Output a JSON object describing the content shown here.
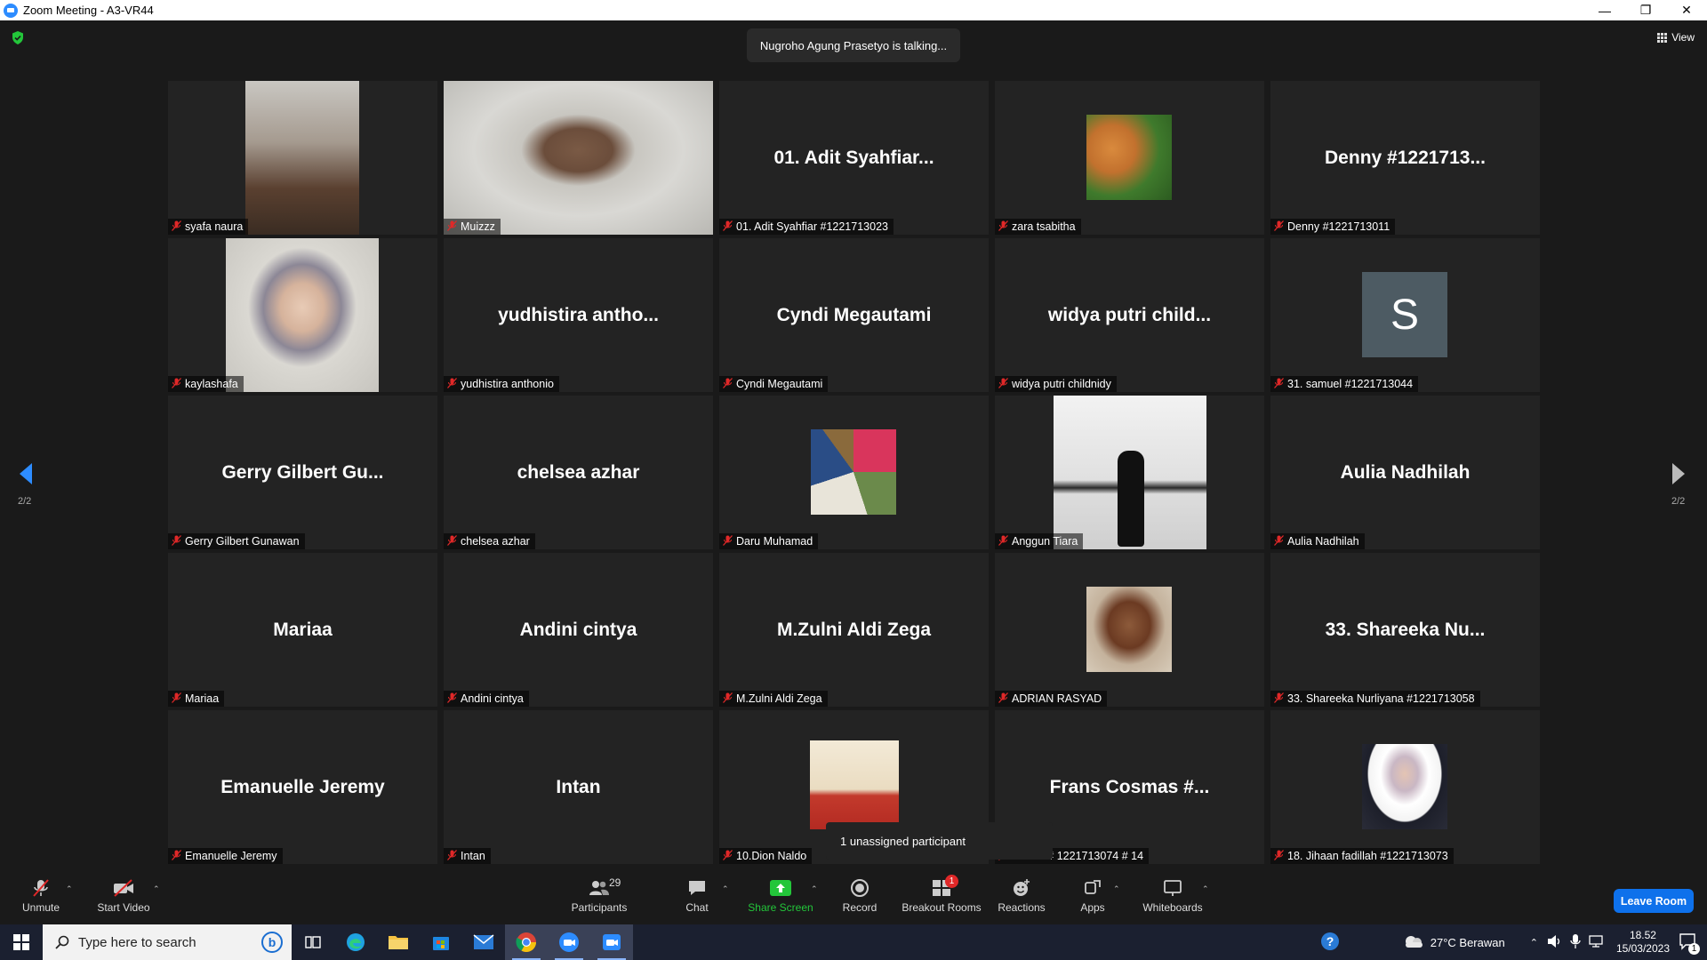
{
  "window": {
    "title": "Zoom Meeting - A3-VR44",
    "minimize_icon": "minimize-icon",
    "maximize_icon": "restore-icon",
    "close_icon": "close-icon"
  },
  "meeting": {
    "talking_banner": "Nugroho Agung Prasetyo is talking...",
    "view_label": "View",
    "page_left": "2/2",
    "page_right": "2/2",
    "unassigned_popup": "1 unassigned participant"
  },
  "tiles": [
    {
      "label": "syafa naura",
      "big": "",
      "video": "v-syafa"
    },
    {
      "label": "Muizzz",
      "big": "",
      "video": "v-muizzz"
    },
    {
      "label": "01. Adit Syahfiar #1221713023",
      "big": "01. Adit Syahfiar...",
      "video": ""
    },
    {
      "label": "zara tsabitha",
      "big": "",
      "video": "t-zara"
    },
    {
      "label": "Denny #1221713011",
      "big": "Denny #1221713...",
      "video": ""
    },
    {
      "label": "kaylashafa",
      "big": "",
      "video": "v-kayla"
    },
    {
      "label": "yudhistira anthonio",
      "big": "yudhistira antho...",
      "video": ""
    },
    {
      "label": "Cyndi Megautami",
      "big": "Cyndi Megautami",
      "video": ""
    },
    {
      "label": "widya putri childnidy",
      "big": "widya putri child...",
      "video": ""
    },
    {
      "label": "31. samuel #1221713044",
      "big": "",
      "video": "t-samuel",
      "avatar_letter": "S"
    },
    {
      "label": "Gerry Gilbert Gunawan",
      "big": "Gerry Gilbert Gu...",
      "video": ""
    },
    {
      "label": "chelsea azhar",
      "big": "chelsea azhar",
      "video": ""
    },
    {
      "label": "Daru Muhamad",
      "big": "",
      "video": "t-daru"
    },
    {
      "label": "Anggun Tiara",
      "big": "",
      "video": "v-anggun"
    },
    {
      "label": "Aulia Nadhilah",
      "big": "Aulia Nadhilah",
      "video": ""
    },
    {
      "label": "Mariaa",
      "big": "Mariaa",
      "video": ""
    },
    {
      "label": "Andini cintya",
      "big": "Andini cintya",
      "video": ""
    },
    {
      "label": "M.Zulni Aldi Zega",
      "big": "M.Zulni Aldi Zega",
      "video": ""
    },
    {
      "label": "ADRIAN RASYAD",
      "big": "",
      "video": "t-adrian"
    },
    {
      "label": "33. Shareeka Nurliyana #1221713058",
      "big": "33. Shareeka Nu...",
      "video": ""
    },
    {
      "label": "Emanuelle Jeremy",
      "big": "Emanuelle Jeremy",
      "video": ""
    },
    {
      "label": "Intan",
      "big": "Intan",
      "video": ""
    },
    {
      "label": "10.Dion Naldo",
      "big": "",
      "video": "t-dion"
    },
    {
      "label": "osmas # 1221713074 # 14",
      "big": "Frans Cosmas #...",
      "video": ""
    },
    {
      "label": "18. Jihaan fadillah #1221713073",
      "big": "",
      "video": "t-jihaan"
    }
  ],
  "toolbar": {
    "unmute": "Unmute",
    "start_video": "Start Video",
    "participants": "Participants",
    "participants_count": "29",
    "chat": "Chat",
    "share_screen": "Share Screen",
    "record": "Record",
    "breakout_rooms": "Breakout Rooms",
    "breakout_badge": "1",
    "reactions": "Reactions",
    "apps": "Apps",
    "whiteboards": "Whiteboards",
    "leave": "Leave Room"
  },
  "taskbar": {
    "search_placeholder": "Type here to search",
    "weather": "27°C  Berawan",
    "time": "18.52",
    "date": "15/03/2023",
    "notification_count": "1"
  },
  "colors": {
    "accent_blue": "#0e71eb",
    "share_green": "#23c63a",
    "muted_red": "#e02828"
  }
}
